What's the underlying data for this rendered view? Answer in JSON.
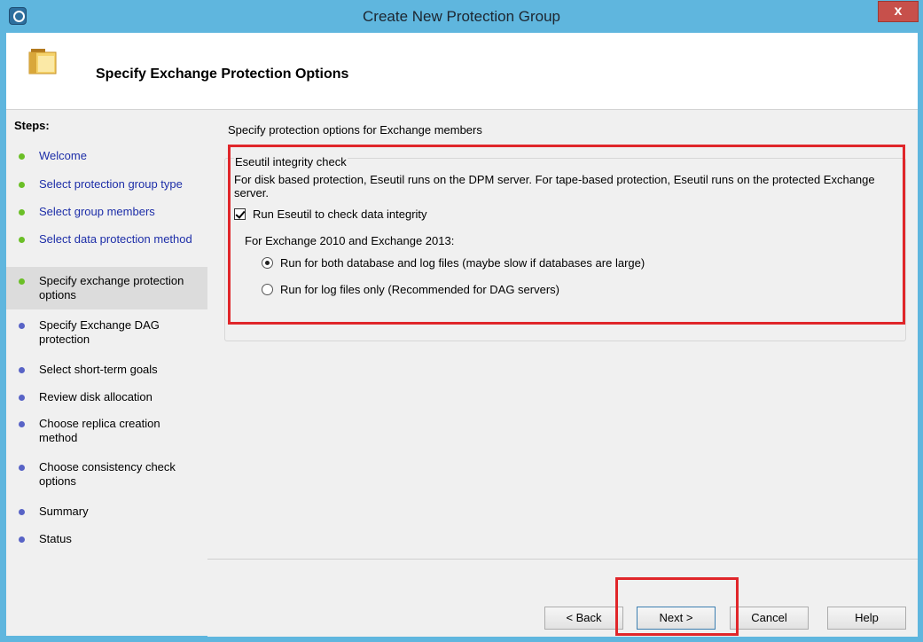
{
  "window": {
    "title": "Create New Protection Group",
    "close_label": "x"
  },
  "header": {
    "title": "Specify Exchange Protection Options",
    "icon": "folder-icon"
  },
  "steps": {
    "title": "Steps:",
    "items": [
      {
        "label": "Welcome",
        "state": "done"
      },
      {
        "label": "Select protection group type",
        "state": "done"
      },
      {
        "label": "Select group members",
        "state": "done"
      },
      {
        "label": "Select data protection method",
        "state": "done"
      },
      {
        "label": "Specify exchange protection options",
        "state": "current"
      },
      {
        "label": "Specify Exchange DAG protection",
        "state": "todo"
      },
      {
        "label": "Select short-term goals",
        "state": "todo"
      },
      {
        "label": "Review disk allocation",
        "state": "todo"
      },
      {
        "label": "Choose replica creation method",
        "state": "todo"
      },
      {
        "label": "Choose consistency check options",
        "state": "todo"
      },
      {
        "label": "Summary",
        "state": "todo"
      },
      {
        "label": "Status",
        "state": "todo"
      }
    ]
  },
  "main": {
    "heading": "Specify protection options for Exchange members",
    "group_title": "Eseutil integrity check",
    "description": "For disk based protection, Eseutil runs on the DPM server. For tape-based protection, Eseutil runs on the protected Exchange server.",
    "checkbox_label": "Run Eseutil to check data integrity",
    "checkbox_checked": true,
    "sub_heading": "For Exchange 2010 and Exchange 2013:",
    "radio_options": [
      {
        "label": "Run for both database and log files (maybe slow if databases are large)",
        "selected": true
      },
      {
        "label": "Run for log files only (Recommended for DAG servers)",
        "selected": false
      }
    ]
  },
  "buttons": {
    "back": "< Back",
    "next": "Next >",
    "cancel": "Cancel",
    "help": "Help"
  },
  "colors": {
    "highlight": "#e0262a",
    "completed_step_text": "#1d2ea8",
    "completed_step_dot": "#6bbf27",
    "pending_step_dot": "#5863c6"
  }
}
